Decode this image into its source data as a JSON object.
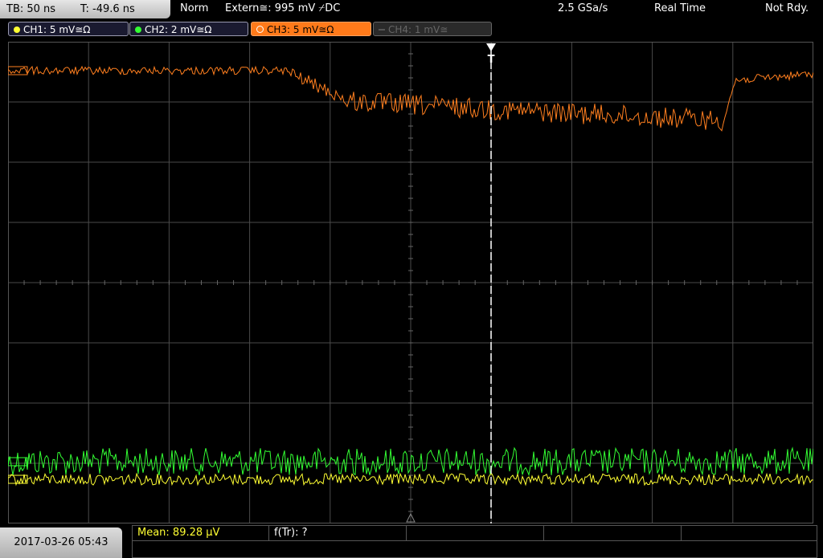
{
  "topbar": {
    "tb_label": "TB: 50 ns",
    "t_label": "T: -49.6 ns",
    "mode": "Norm",
    "trigger": "Extern≅: 995 mV ⌿DC",
    "sample_rate": "2.5 GSa/s",
    "acq_mode": "Real Time",
    "state": "Not Rdy."
  },
  "channels": [
    {
      "label": "CH1: 5 mV≅Ω",
      "color": "#ffff33",
      "state": "on"
    },
    {
      "label": "CH2: 2 mV≅Ω",
      "color": "#33ff33",
      "state": "on"
    },
    {
      "label": "CH3: 5 mV≅Ω",
      "color": "#ff7f1f",
      "state": "selected"
    },
    {
      "label": "CH4: 1 mV≅",
      "color": "#777777",
      "state": "off"
    }
  ],
  "trigger_marker": "T",
  "bottom": {
    "datetime": "2017-03-26 05:43",
    "mean": "Mean: 89.28 µV",
    "ftr": "f(Tr): ?"
  },
  "colors": {
    "ch1": "#ffff33",
    "ch2": "#33ff33",
    "ch3": "#ff7f1f",
    "grid": "#4a4a4a"
  }
}
